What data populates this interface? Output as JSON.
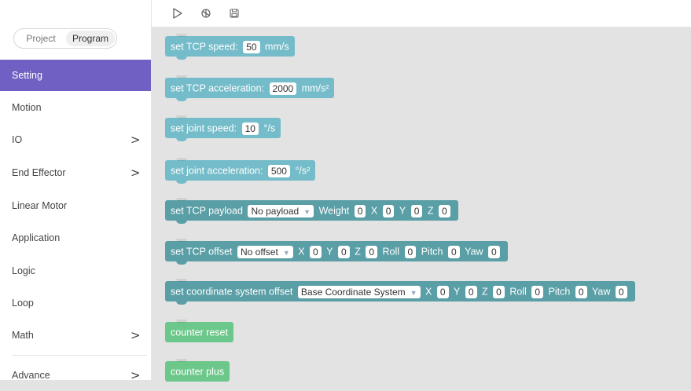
{
  "sidebar": {
    "segment": {
      "project": "Project",
      "program": "Program",
      "selected": "Program"
    },
    "items": [
      {
        "label": "Setting",
        "chevron": ""
      },
      {
        "label": "Motion",
        "chevron": ""
      },
      {
        "label": "IO",
        "chevron": ">"
      },
      {
        "label": "End Effector",
        "chevron": ">"
      },
      {
        "label": "Linear Motor",
        "chevron": ""
      },
      {
        "label": "Application",
        "chevron": ""
      },
      {
        "label": "Logic",
        "chevron": ""
      },
      {
        "label": "Loop",
        "chevron": ""
      },
      {
        "label": "Math",
        "chevron": ">"
      },
      {
        "label": "Advance",
        "chevron": ">"
      }
    ],
    "active_index": 0,
    "active_color": "#7060c4"
  },
  "toolbar": {
    "icons": [
      "play-icon",
      "debug-icon",
      "save-icon"
    ]
  },
  "blocks": {
    "tcp_speed": {
      "prefix": "set TCP speed:",
      "value": "50",
      "unit": "mm/s"
    },
    "tcp_accel": {
      "prefix": "set TCP acceleration:",
      "value": "2000",
      "unit": "mm/s²"
    },
    "joint_speed": {
      "prefix": "set joint speed:",
      "value": "10",
      "unit": "°/s"
    },
    "joint_accel": {
      "prefix": "set joint acceleration:",
      "value": "500",
      "unit": "°/s²"
    },
    "tcp_payload": {
      "prefix": "set TCP payload",
      "dropdown": "No payload",
      "weight_label": "Weight",
      "weight": "0",
      "x_label": "X",
      "x": "0",
      "y_label": "Y",
      "y": "0",
      "z_label": "Z",
      "z": "0"
    },
    "tcp_offset": {
      "prefix": "set TCP offset",
      "dropdown": "No offset",
      "x_label": "X",
      "x": "0",
      "y_label": "Y",
      "y": "0",
      "z_label": "Z",
      "z": "0",
      "roll_label": "Roll",
      "roll": "0",
      "pitch_label": "Pitch",
      "pitch": "0",
      "yaw_label": "Yaw",
      "yaw": "0"
    },
    "coord_offset": {
      "prefix": "set coordinate system offset",
      "dropdown": "Base Coordinate System",
      "x_label": "X",
      "x": "0",
      "y_label": "Y",
      "y": "0",
      "z_label": "Z",
      "z": "0",
      "roll_label": "Roll",
      "roll": "0",
      "pitch_label": "Pitch",
      "pitch": "0",
      "yaw_label": "Yaw",
      "yaw": "0"
    },
    "counter_reset": {
      "label": "counter reset"
    },
    "counter_plus": {
      "label": "counter plus"
    }
  },
  "colors": {
    "setting_block": "#74bcc9",
    "teal_block": "#5a9ea6",
    "counter_block": "#6cc78a",
    "workspace": "#e3e3e3"
  }
}
